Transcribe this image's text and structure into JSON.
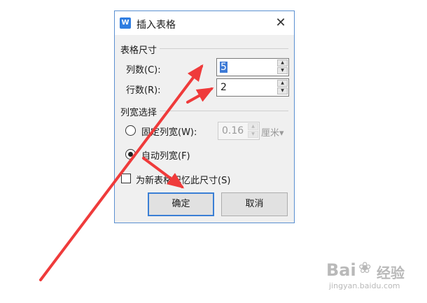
{
  "dialog": {
    "app_icon": "W",
    "title": "插入表格",
    "close_glyph": "✕",
    "table_size": {
      "group_title": "表格尺寸",
      "columns_label": "列数(C):",
      "columns_value": "5",
      "rows_label": "行数(R):",
      "rows_value": "2"
    },
    "col_width": {
      "group_title": "列宽选择",
      "fixed_label": "固定列宽(W):",
      "fixed_value": "0.16",
      "unit_label": "厘米▾",
      "auto_label": "自动列宽(F)",
      "selected": "auto"
    },
    "remember_label": "为新表格记忆此尺寸(S)",
    "remember_checked": false,
    "ok_label": "确定",
    "cancel_label": "取消"
  },
  "watermark": {
    "brand_top": "Bai",
    "brand_mid": "经验",
    "url": "jingyan.baidu.com"
  },
  "colors": {
    "annotation_arrow": "#ef3b3b",
    "dialog_border": "#5a8fd1",
    "selection": "#3d7ad6"
  }
}
